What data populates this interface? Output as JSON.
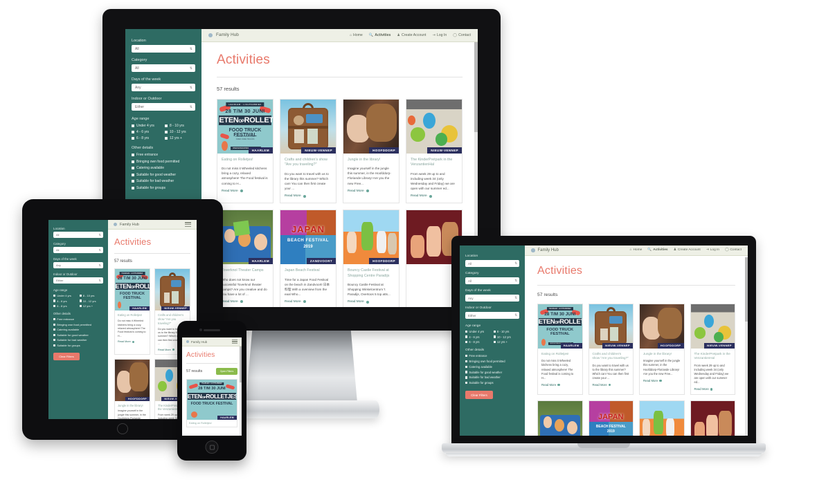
{
  "site": {
    "brand": "Family Hub",
    "page_title": "Activities",
    "results_label": "57 results",
    "nav": [
      {
        "label": "Home",
        "icon": "home-icon"
      },
      {
        "label": "Activities",
        "icon": "search-icon"
      },
      {
        "label": "Create Account",
        "icon": "user-icon"
      },
      {
        "label": "Log In",
        "icon": "login-icon"
      },
      {
        "label": "Contact",
        "icon": "chat-icon"
      }
    ],
    "filters": {
      "location": {
        "label": "Location",
        "value": "All"
      },
      "category": {
        "label": "Category",
        "value": "All"
      },
      "days": {
        "label": "Days of the week",
        "value": "Any"
      },
      "indoor": {
        "label": "Indoor or Outdoor",
        "value": "Either"
      },
      "age_label": "Age range",
      "age_options": [
        "Under 4 yrs",
        "8 - 10 yrs",
        "4 - 6 yrs",
        "10 - 12 yrs",
        "6 - 8 yrs",
        "12 yrs +"
      ],
      "other_label": "Other details",
      "other_options": [
        "Free entrance",
        "Bringing own food permitted",
        "Catering available",
        "Suitable for good weather",
        "Suitable for bad weather",
        "Suitable for groups"
      ],
      "clear_button": "Clear Filters",
      "open_button": "Open Filters"
    },
    "read_more": "Read More",
    "cards": [
      {
        "title": "Eating on Rolletjes!",
        "desc": "Do not miss it Wheeled kitchens bring a cozy, relaxed atmosphere! The Food festival is coming to H...",
        "tag": "HAARLEM",
        "art": "art-food",
        "poster": {
          "kicker": "HAARLEM · LICHTFABRIEK",
          "dates": "28 T/M 30 JUNI",
          "title1": "ETEN",
          "title_sm": "OP",
          "title2": "ROLLETJES",
          "subtitle": "FOOD TRUCK FESTIVAL",
          "fine": "WWW.ETENOPROLLETJES.NL"
        }
      },
      {
        "title": "Crafts and children's show \"Are you traveling?\"",
        "desc": "Do you want to travel with us to the library this summer? Which can! You can then first create your ...",
        "tag": "NIEUW-VENNEP",
        "art": "art-suitcase"
      },
      {
        "title": "Jungle in the library!",
        "desc": "Imagine yourself in the jungle this summer, in the Hoofddorp-Floriande Library! Are you the new Free...",
        "tag": "HOOFDDORP",
        "art": "art-jungle"
      },
      {
        "title": "The KinderPretpark in the VenzantienHal",
        "desc": "From week 29 up to and including week 34 (only Wednesday and Friday) we are open with our summer ed...",
        "tag": "NIEUW-VENNEP",
        "art": "art-kinder"
      },
      {
        "title": "Toverknol Theater Camps",
        "desc": "Who does not know our successful Toverknol theater camps? Are you creative and do you have a lot of ...",
        "tag": "HAARLEM",
        "art": "art-tent"
      },
      {
        "title": "Japan Beach Festival",
        "desc": "Time for a Japan Food Festival on the beach in Zandvoort! 日本料理 With a overview from the eaal Who...",
        "tag": "ZANDVOORT",
        "art": "art-japan",
        "poster": {
          "title1": "JAPAN",
          "subtitle": "BEACH FESTIVAL",
          "fine": "2019"
        }
      },
      {
        "title": "Bouncy Castle Festival at Shopping Centre Paradijs",
        "desc": "Bouncy Castle Festival at Shopping Winkelcentrum 't Paradijs, Overtoos 5 top atts...",
        "tag": "HOOFDDORP",
        "art": "art-bouncy"
      },
      {
        "title": "",
        "desc": "",
        "tag": "",
        "art": "art-chalk"
      }
    ]
  },
  "devices": {
    "monitor": "desktop-monitor",
    "tablet": "tablet",
    "phone": "phone",
    "laptop": "laptop"
  }
}
